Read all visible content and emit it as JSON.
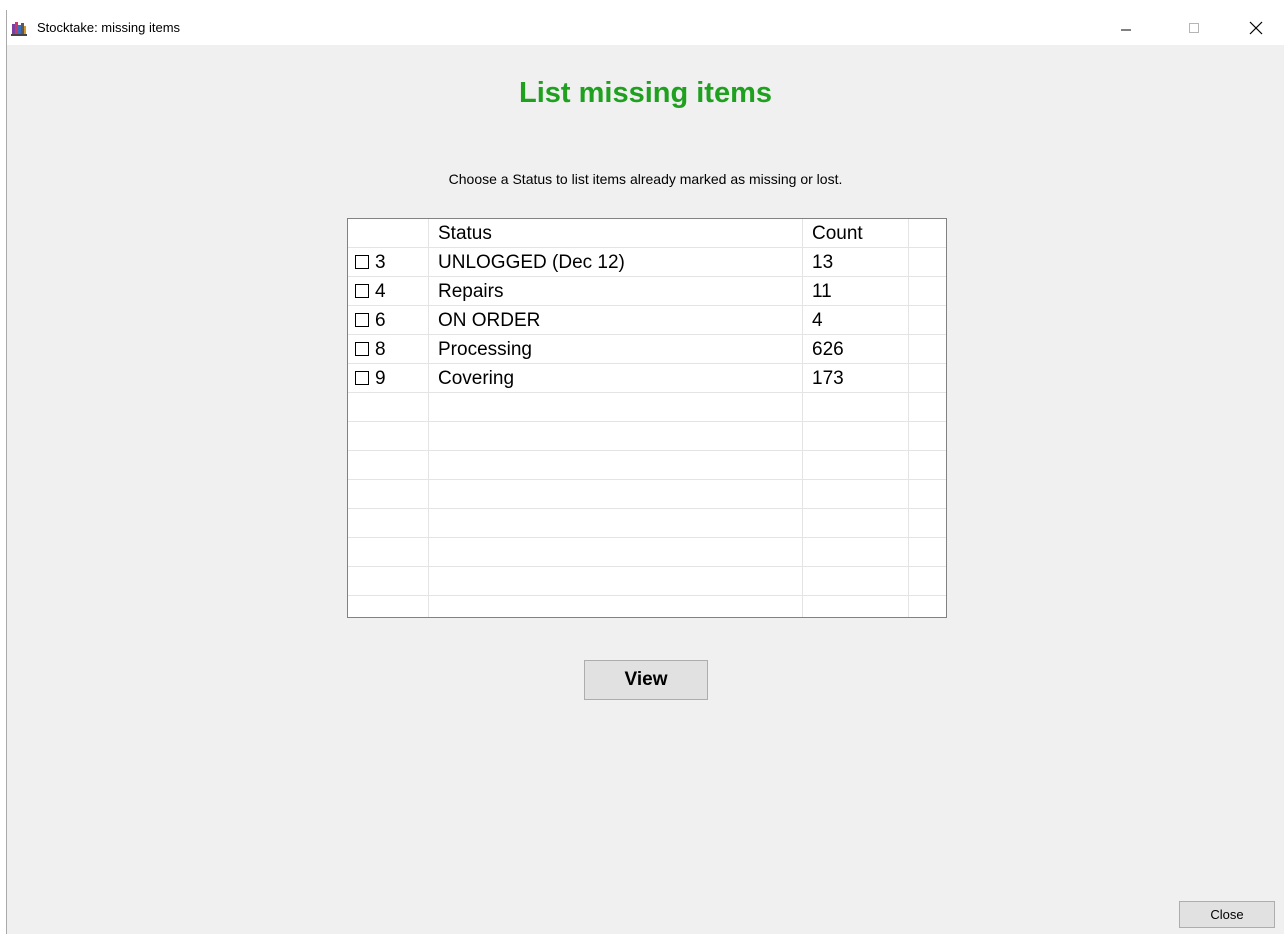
{
  "window": {
    "title": "Stocktake: missing items",
    "app_icon": "books-icon",
    "controls": {
      "minimize_icon": "minimize-icon",
      "maximize_icon": "maximize-icon",
      "close_icon": "close-icon"
    }
  },
  "main": {
    "title": "List missing items",
    "title_color": "#1fa01f",
    "instructions": "Choose a Status to list items already marked as missing or lost."
  },
  "grid": {
    "columns": [
      "",
      "Status",
      "Count"
    ],
    "rows": [
      {
        "code": "3",
        "status": "UNLOGGED (Dec 12)",
        "count": "13",
        "checked": false
      },
      {
        "code": "4",
        "status": "Repairs",
        "count": "11",
        "checked": false
      },
      {
        "code": "6",
        "status": "ON ORDER",
        "count": "4",
        "checked": false
      },
      {
        "code": "8",
        "status": "Processing",
        "count": "626",
        "checked": false
      },
      {
        "code": "9",
        "status": "Covering",
        "count": "173",
        "checked": false
      }
    ]
  },
  "buttons": {
    "view": "View",
    "close": "Close"
  }
}
